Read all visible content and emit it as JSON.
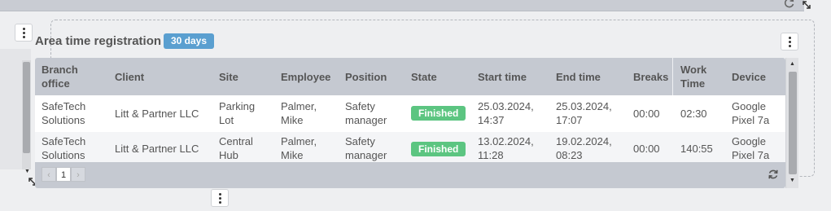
{
  "widget": {
    "title": "Area time registration",
    "range_badge": "30 days"
  },
  "table": {
    "columns": [
      "Branch office",
      "Client",
      "Site",
      "Employee",
      "Position",
      "State",
      "Start time",
      "End time",
      "Breaks",
      "Work Time",
      "Device"
    ],
    "rows": [
      {
        "branch": [
          "SafeTech",
          "Solutions"
        ],
        "client": "Litt & Partner LLC",
        "site": [
          "Parking",
          "Lot"
        ],
        "employee": [
          "Palmer,",
          "Mike"
        ],
        "position": [
          "Safety",
          "manager"
        ],
        "state": "Finished",
        "start": [
          "25.03.2024,",
          "14:37"
        ],
        "end": [
          "25.03.2024,",
          "17:07"
        ],
        "breaks": "00:00",
        "work_time": "02:30",
        "device": [
          "Google",
          "Pixel 7a"
        ]
      },
      {
        "branch": [
          "SafeTech",
          "Solutions"
        ],
        "client": "Litt & Partner LLC",
        "site": [
          "Central",
          "Hub"
        ],
        "employee": [
          "Palmer,",
          "Mike"
        ],
        "position": [
          "Safety",
          "manager"
        ],
        "state": "Finished",
        "start": [
          "13.02.2024,",
          "11:28"
        ],
        "end": [
          "19.02.2024,",
          "08:23"
        ],
        "breaks": "00:00",
        "work_time": "140:55",
        "device": [
          "Google",
          "Pixel 7a"
        ]
      }
    ],
    "pagination": {
      "prev": "‹",
      "current_page": "1",
      "next": "›"
    }
  },
  "colors": {
    "badge_blue": "#5a9fd0",
    "state_finished": "#5cc581",
    "header_gray": "#c5c9d1"
  },
  "icons": {
    "menu": "kebab-menu-icon",
    "refresh": "refresh-icon",
    "resize": "resize-handle-icon"
  }
}
